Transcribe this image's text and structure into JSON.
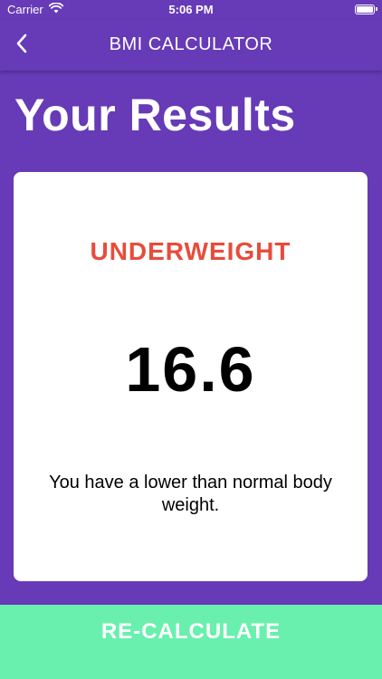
{
  "status_bar": {
    "carrier": "Carrier",
    "time": "5:06 PM",
    "icons": [
      "wifi-icon",
      "battery-icon"
    ]
  },
  "app_bar": {
    "title": "BMI CALCULATOR",
    "back_icon": "chevron-left-icon"
  },
  "page": {
    "title": "Your Results"
  },
  "result": {
    "category": "UNDERWEIGHT",
    "bmi": "16.6",
    "interpretation": "You have a lower than normal body weight."
  },
  "action": {
    "label": "RE-CALCULATE"
  },
  "colors": {
    "background": "#673AB7",
    "card": "#ffffff",
    "category": "#E74C3C",
    "button": "#69F0AE"
  }
}
